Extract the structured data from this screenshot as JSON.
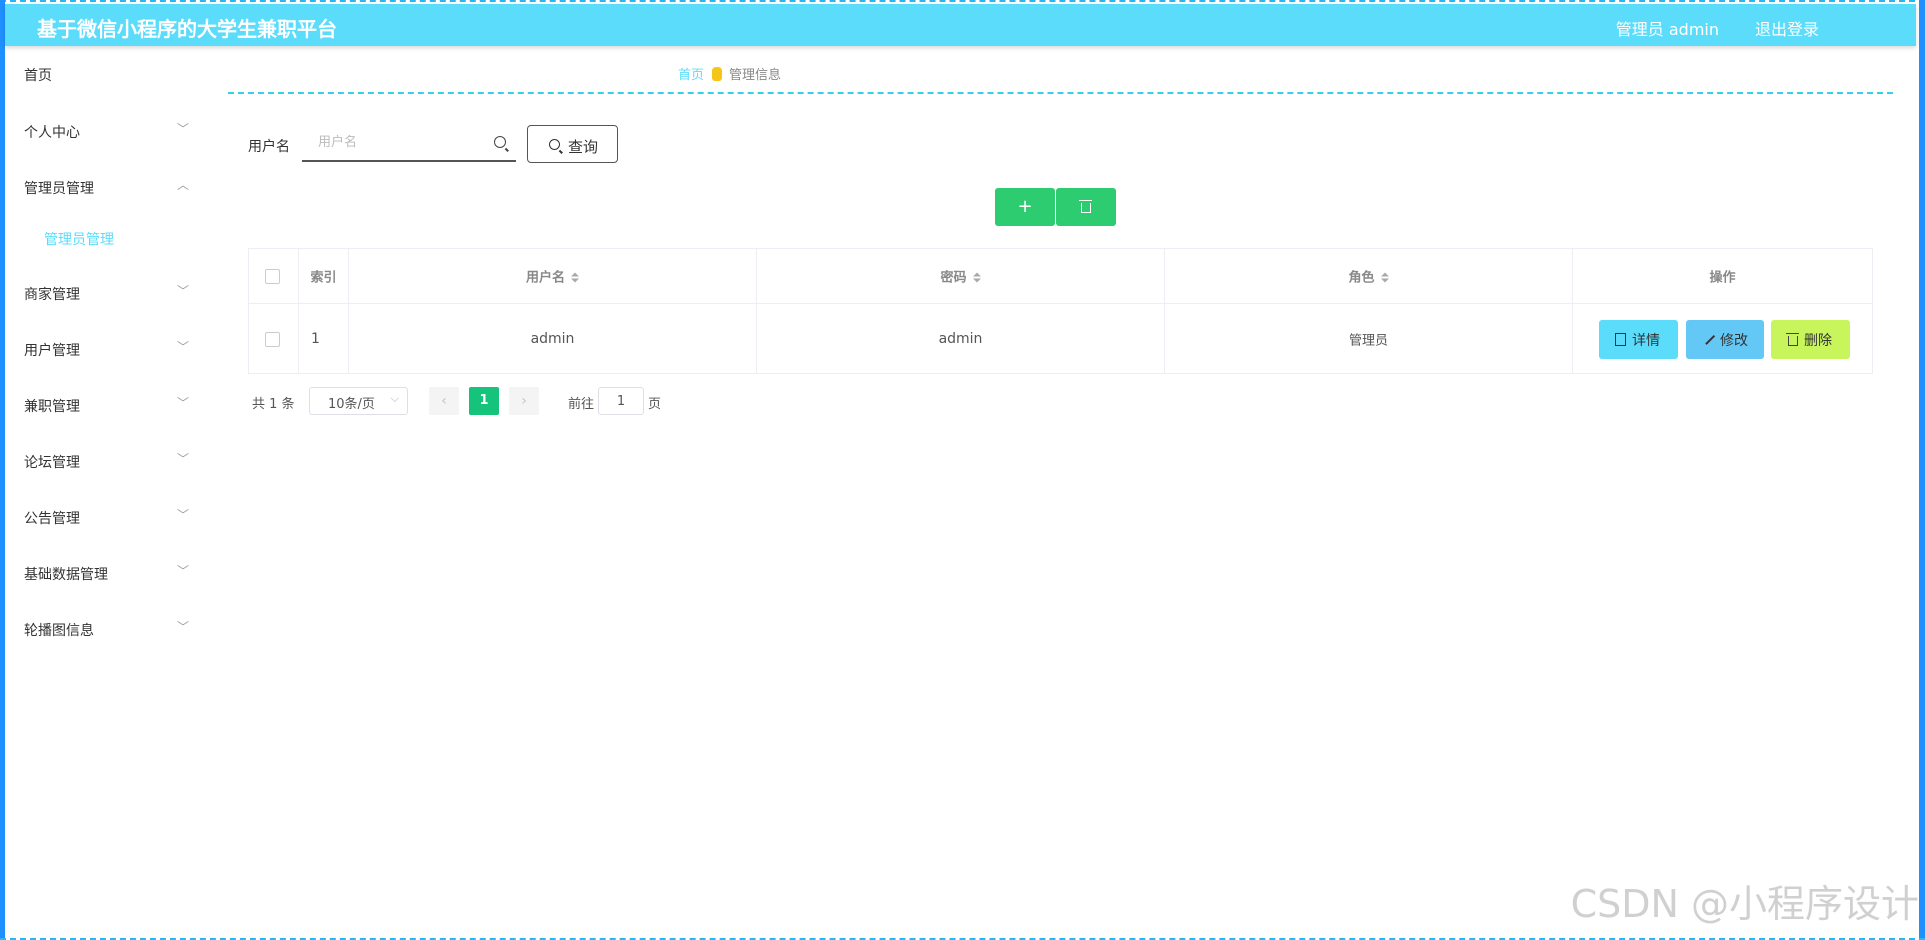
{
  "header": {
    "title": "基于微信小程序的大学生兼职平台",
    "user": "管理员 admin",
    "logout": "退出登录"
  },
  "sidebar": {
    "home": "首页",
    "items": [
      {
        "label": "个人中心",
        "chevron": "﹀"
      },
      {
        "label": "管理员管理",
        "chevron": "︿"
      },
      {
        "label": "商家管理",
        "chevron": "﹀"
      },
      {
        "label": "用户管理",
        "chevron": "﹀"
      },
      {
        "label": "兼职管理",
        "chevron": "﹀"
      },
      {
        "label": "论坛管理",
        "chevron": "﹀"
      },
      {
        "label": "公告管理",
        "chevron": "﹀"
      },
      {
        "label": "基础数据管理",
        "chevron": "﹀"
      },
      {
        "label": "轮播图信息",
        "chevron": "﹀"
      }
    ],
    "submenu": "管理员管理"
  },
  "breadcrumb": {
    "home": "首页",
    "current": "管理信息"
  },
  "search": {
    "label": "用户名",
    "placeholder": "用户名",
    "value": "",
    "button": "查询"
  },
  "actions": {
    "add": "+"
  },
  "table": {
    "headers": [
      "索引",
      "用户名",
      "密码",
      "角色",
      "操作"
    ],
    "rows": [
      {
        "index": "1",
        "username": "admin",
        "password": "admin",
        "role": "管理员"
      }
    ],
    "ops": {
      "detail": "详情",
      "edit": "修改",
      "delete": "删除"
    }
  },
  "pagination": {
    "total": "共 1 条",
    "page_size": "10条/页",
    "current": "1",
    "goto_label": "前往",
    "goto_value": "1",
    "goto_unit": "页",
    "prev": "‹",
    "next": "›",
    "select_chevron": "⌵"
  },
  "watermark": "CSDN @小程序设计",
  "colors": {
    "header": "#5bdcfb",
    "primary_green": "#2ecc71",
    "page_active": "#16c37a",
    "detail": "#5bdcfb",
    "edit": "#64c8f7",
    "delete": "#c9f55c"
  }
}
